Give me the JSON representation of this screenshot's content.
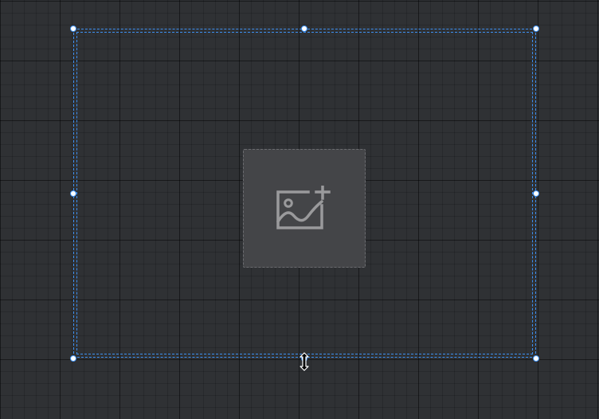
{
  "canvas": {
    "background": "#2f3134",
    "grid": true
  },
  "selection": {
    "accent_color": "#3d8ff0",
    "handle_count": 8
  },
  "image_placeholder": {
    "icon": "add-image-icon",
    "icon_color": "#9a9a9c",
    "background": "#444548"
  },
  "cursor": {
    "icon": "resize-vertical-cursor-icon"
  }
}
